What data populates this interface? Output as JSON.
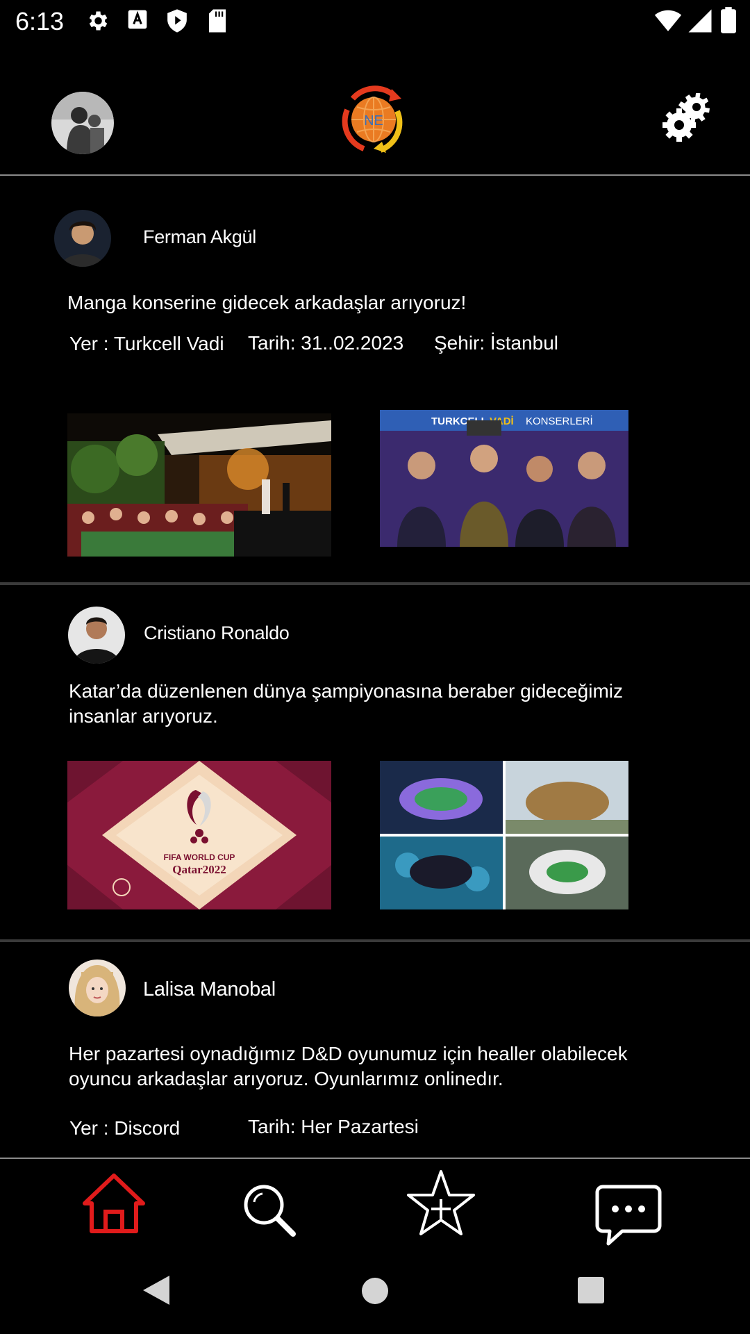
{
  "status_bar": {
    "time": "6:13",
    "icons_left": [
      "settings-icon",
      "text-a-icon",
      "shield-play-icon",
      "sd-card-icon"
    ],
    "icons_right": [
      "wifi-icon",
      "signal-icon",
      "battery-icon"
    ]
  },
  "header": {
    "logo_text": "NE",
    "left_icon": "profile-avatar",
    "right_icon": "gears-icon"
  },
  "posts": [
    {
      "author": "Ferman Akgül",
      "text": "Manga konserine gidecek arkadaşlar arıyoruz!",
      "place": "Yer : Turkcell Vadi",
      "date": "Tarih: 31..02.2023",
      "city": "Şehir: İstanbul",
      "image2_caption_a": "TURKCELL",
      "image2_caption_b": "VADİ",
      "image2_caption_c": "KONSERLERİ"
    },
    {
      "author": "Cristiano Ronaldo",
      "text_line1": "Katar’da düzenlenen dünya şampiyonasına beraber gideceğimiz",
      "text_line2": "insanlar arıyoruz.",
      "image1_caption_a": "FIFA WORLD CUP",
      "image1_caption_b": "Qatar2022"
    },
    {
      "author": "Lalisa Manobal",
      "text_line1": "Her pazartesi oynadığımız D&D oyunumuz için healler olabilecek",
      "text_line2": "oyuncu arkadaşlar arıyoruz. Oyunlarımız onlinedır.",
      "place": "Yer : Discord",
      "date": "Tarih: Her Pazartesi"
    }
  ],
  "bottom_nav": {
    "items": [
      "home-icon",
      "search-icon",
      "star-add-icon",
      "chat-icon"
    ],
    "active_color": "#e11b1b"
  }
}
